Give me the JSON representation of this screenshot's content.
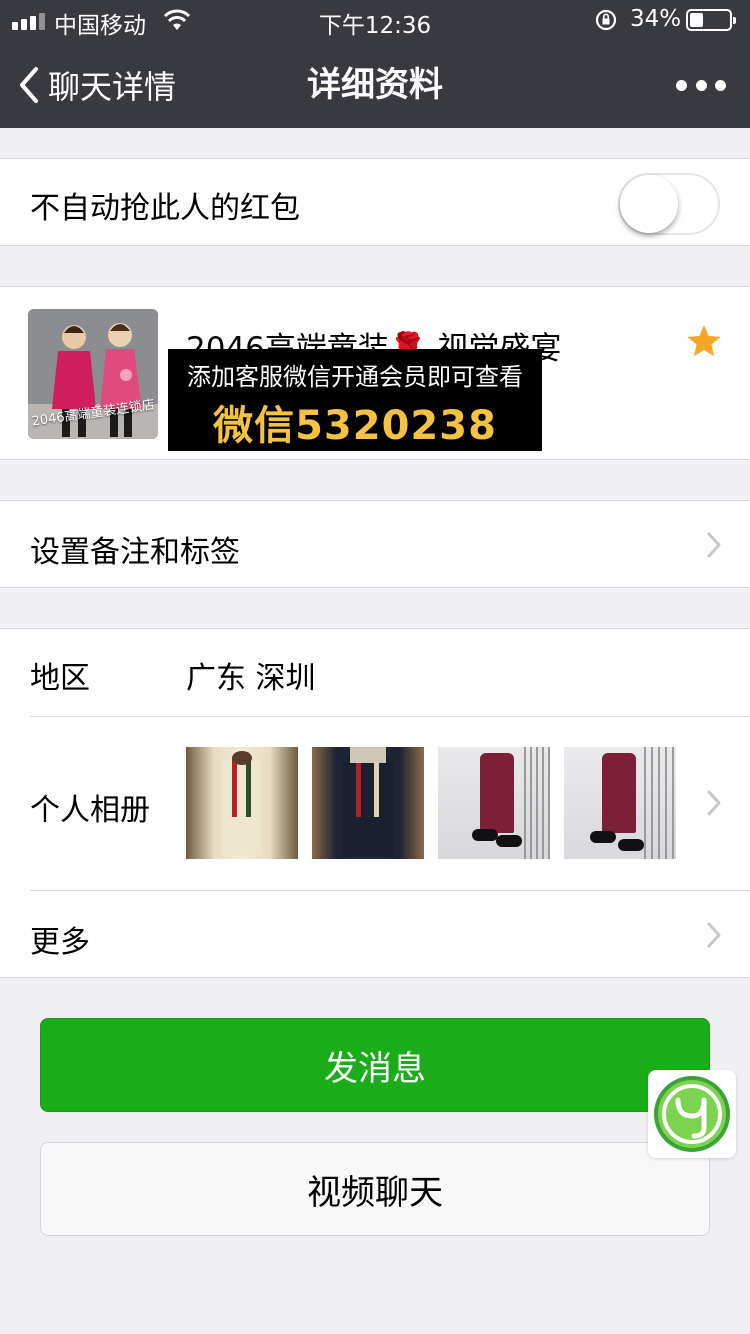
{
  "status_bar": {
    "carrier": "中国移动",
    "time": "下午12:36",
    "battery_percent": "34%",
    "battery_level": 0.34
  },
  "nav": {
    "back_label": "聊天详情",
    "title": "详细资料"
  },
  "red_packet": {
    "label": "不自动抢此人的红包",
    "toggle_on": false
  },
  "profile": {
    "name": "2046高端童装🌹 视觉盛宴",
    "avatar_caption": "2046高端童装连锁店",
    "promo_line1": "添加客服微信开通会员即可查看",
    "promo_line2": "微信5320238",
    "starred": true
  },
  "remark": {
    "label": "设置备注和标签"
  },
  "details": {
    "region_label": "地区",
    "region_value": "广东 深圳",
    "album_label": "个人相册",
    "more_label": "更多"
  },
  "buttons": {
    "message": "发消息",
    "video_call": "视频聊天"
  },
  "colors": {
    "nav_bg": "#393a3f",
    "primary_green": "#1aad19",
    "page_bg": "#efeff4",
    "star": "#f5a623"
  }
}
